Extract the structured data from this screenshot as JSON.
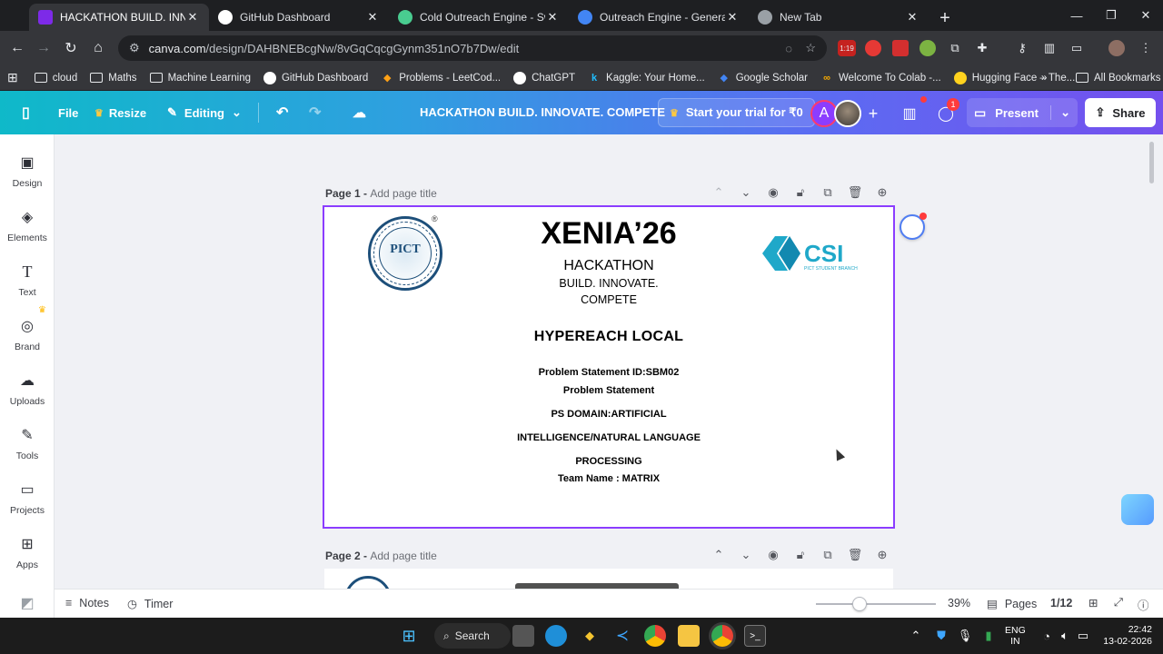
{
  "browser": {
    "tabs": [
      {
        "title": "HACKATHON BUILD. INNOVATE",
        "active": true,
        "favicon_color": "#7d2ae8"
      },
      {
        "title": "GitHub Dashboard",
        "active": false,
        "favicon_color": "#ffffff"
      },
      {
        "title": "Cold Outreach Engine - Swagger",
        "active": false,
        "favicon_color": "#49cc90"
      },
      {
        "title": "Outreach Engine - Generate Co",
        "active": false,
        "favicon_color": "#4285f4"
      },
      {
        "title": "New Tab",
        "active": false,
        "favicon_color": "#9aa0a6"
      }
    ],
    "url_host": "canva.com",
    "url_path": "/design/DAHBNEBcgNw/8vGqCqcgGynm351nO7b7Dw/edit",
    "extension_badge": "1:19"
  },
  "bookmarks": [
    {
      "label": "cloud",
      "icon": "folder-icon"
    },
    {
      "label": "Maths",
      "icon": "folder-icon"
    },
    {
      "label": "Machine Learning",
      "icon": "folder-icon"
    },
    {
      "label": "GitHub Dashboard",
      "icon": "github-icon"
    },
    {
      "label": "Problems - LeetCod...",
      "icon": "leetcode-icon"
    },
    {
      "label": "ChatGPT",
      "icon": "chatgpt-icon"
    },
    {
      "label": "Kaggle: Your Home...",
      "icon": "kaggle-icon"
    },
    {
      "label": "Google Scholar",
      "icon": "scholar-icon"
    },
    {
      "label": "Welcome To Colab -...",
      "icon": "colab-icon"
    },
    {
      "label": "Hugging Face – The...",
      "icon": "huggingface-icon"
    }
  ],
  "bookmarks_all": "All Bookmarks",
  "canva": {
    "file": "File",
    "resize": "Resize",
    "editing": "Editing",
    "doc_title": "HACKATHON BUILD. INNOVATE. COMPETE",
    "trial": "Start your trial for ₹0",
    "avatar_letter": "A",
    "comments_badge": "1",
    "present": "Present",
    "share": "Share",
    "accent": "#8b3dff"
  },
  "sidebar": [
    {
      "label": "Design",
      "icon": "design-icon"
    },
    {
      "label": "Elements",
      "icon": "elements-icon"
    },
    {
      "label": "Text",
      "icon": "text-icon"
    },
    {
      "label": "Brand",
      "icon": "brand-icon"
    },
    {
      "label": "Uploads",
      "icon": "uploads-icon"
    },
    {
      "label": "Tools",
      "icon": "tools-icon"
    },
    {
      "label": "Projects",
      "icon": "projects-icon"
    },
    {
      "label": "Apps",
      "icon": "apps-icon"
    }
  ],
  "pages": [
    {
      "label": "Page 1 -",
      "placeholder": "Add page title"
    },
    {
      "label": "Page 2 -",
      "placeholder": "Add page title"
    }
  ],
  "slide": {
    "pict_word": "PICT",
    "pict_reg": "®",
    "csi_word": "CSI",
    "csi_sub": "PICT STUDENT BRANCH",
    "event": "XENIA’26",
    "hackathon": "HACKATHON",
    "tagline_1": "BUILD. INNOVATE.",
    "tagline_2": "COMPETE",
    "team_title": "HYPEREACH LOCAL",
    "ps_id": "Problem Statement ID:SBM02",
    "ps_label": "Problem Statement",
    "ps_domain_1": "PS DOMAIN:ARTIFICIAL",
    "ps_domain_2": "INTELLIGENCE/NATURAL LANGUAGE",
    "ps_domain_3": "PROCESSING",
    "team_name": "Team Name : MATRIX"
  },
  "footer": {
    "notes": "Notes",
    "timer": "Timer",
    "zoom": "39%",
    "zoom_fraction": 0.39,
    "pages": "Pages",
    "page_count": "1/12"
  },
  "taskbar": {
    "search": "Search",
    "lang_1": "ENG",
    "lang_2": "IN",
    "time": "22:42",
    "date": "13-02-2026"
  }
}
